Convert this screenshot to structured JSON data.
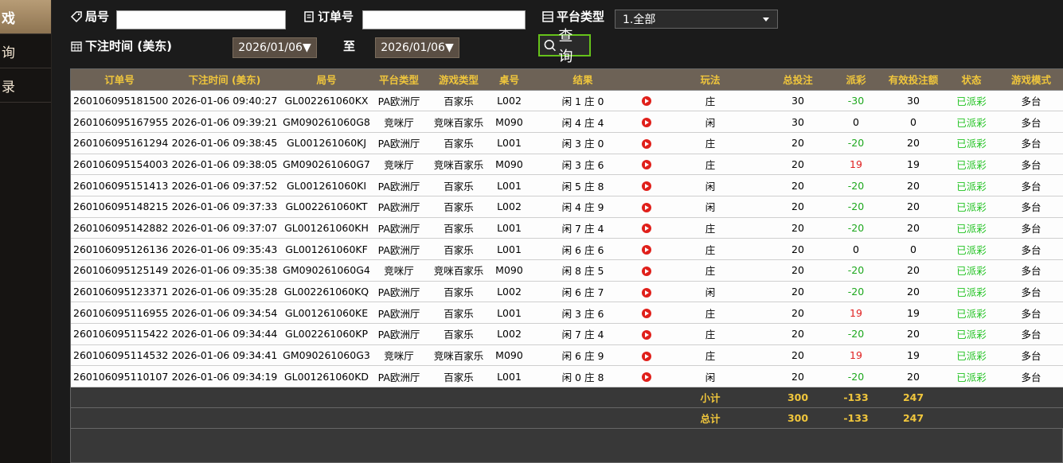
{
  "sidebar": {
    "items": [
      {
        "label": "戏",
        "active": true
      },
      {
        "label": "询",
        "active": false
      },
      {
        "label": "录",
        "active": false
      }
    ]
  },
  "filters": {
    "round_label": "局号",
    "round_value": "",
    "order_label": "订单号",
    "order_value": "",
    "platform_label": "平台类型",
    "platform_selected": "1.全部",
    "bet_time_label": "下注时间 (美东)",
    "date_from": "2026/01/06▼",
    "to_label": "至",
    "date_to": "2026/01/06▼",
    "search_label": "查询"
  },
  "table": {
    "headers": [
      "订单号",
      "下注时间 (美东)",
      "局号",
      "平台类型",
      "游戏类型",
      "桌号",
      "结果",
      "",
      "玩法",
      "总投注",
      "派彩",
      "有效投注额",
      "状态",
      "游戏模式"
    ],
    "rows": [
      {
        "order": "260106095181500",
        "time": "2026-01-06 09:40:27",
        "round": "GL002261060KX",
        "platform": "PA欧洲厅",
        "game": "百家乐",
        "table": "L002",
        "result": "闲 1 庄 0",
        "play": "庄",
        "bet": "30",
        "payout": "-30",
        "payout_type": "neg",
        "valid": "30",
        "status": "已派彩",
        "mode": "多台"
      },
      {
        "order": "260106095167955",
        "time": "2026-01-06 09:39:21",
        "round": "GM090261060G8",
        "platform": "竞咪厅",
        "game": "竞咪百家乐",
        "table": "M090",
        "result": "闲 4 庄 4",
        "play": "闲",
        "bet": "30",
        "payout": "0",
        "payout_type": "zero",
        "valid": "0",
        "status": "已派彩",
        "mode": "多台"
      },
      {
        "order": "260106095161294",
        "time": "2026-01-06 09:38:45",
        "round": "GL001261060KJ",
        "platform": "PA欧洲厅",
        "game": "百家乐",
        "table": "L001",
        "result": "闲 3 庄 0",
        "play": "庄",
        "bet": "20",
        "payout": "-20",
        "payout_type": "neg",
        "valid": "20",
        "status": "已派彩",
        "mode": "多台"
      },
      {
        "order": "260106095154003",
        "time": "2026-01-06 09:38:05",
        "round": "GM090261060G7",
        "platform": "竞咪厅",
        "game": "竞咪百家乐",
        "table": "M090",
        "result": "闲 3 庄 6",
        "play": "庄",
        "bet": "20",
        "payout": "19",
        "payout_type": "pos",
        "valid": "19",
        "status": "已派彩",
        "mode": "多台"
      },
      {
        "order": "260106095151413",
        "time": "2026-01-06 09:37:52",
        "round": "GL001261060KI",
        "platform": "PA欧洲厅",
        "game": "百家乐",
        "table": "L001",
        "result": "闲 5 庄 8",
        "play": "闲",
        "bet": "20",
        "payout": "-20",
        "payout_type": "neg",
        "valid": "20",
        "status": "已派彩",
        "mode": "多台"
      },
      {
        "order": "260106095148215",
        "time": "2026-01-06 09:37:33",
        "round": "GL002261060KT",
        "platform": "PA欧洲厅",
        "game": "百家乐",
        "table": "L002",
        "result": "闲 4 庄 9",
        "play": "闲",
        "bet": "20",
        "payout": "-20",
        "payout_type": "neg",
        "valid": "20",
        "status": "已派彩",
        "mode": "多台"
      },
      {
        "order": "260106095142882",
        "time": "2026-01-06 09:37:07",
        "round": "GL001261060KH",
        "platform": "PA欧洲厅",
        "game": "百家乐",
        "table": "L001",
        "result": "闲 7 庄 4",
        "play": "庄",
        "bet": "20",
        "payout": "-20",
        "payout_type": "neg",
        "valid": "20",
        "status": "已派彩",
        "mode": "多台"
      },
      {
        "order": "260106095126136",
        "time": "2026-01-06 09:35:43",
        "round": "GL001261060KF",
        "platform": "PA欧洲厅",
        "game": "百家乐",
        "table": "L001",
        "result": "闲 6 庄 6",
        "play": "庄",
        "bet": "20",
        "payout": "0",
        "payout_type": "zero",
        "valid": "0",
        "status": "已派彩",
        "mode": "多台"
      },
      {
        "order": "260106095125149",
        "time": "2026-01-06 09:35:38",
        "round": "GM090261060G4",
        "platform": "竞咪厅",
        "game": "竞咪百家乐",
        "table": "M090",
        "result": "闲 8 庄 5",
        "play": "庄",
        "bet": "20",
        "payout": "-20",
        "payout_type": "neg",
        "valid": "20",
        "status": "已派彩",
        "mode": "多台"
      },
      {
        "order": "260106095123371",
        "time": "2026-01-06 09:35:28",
        "round": "GL002261060KQ",
        "platform": "PA欧洲厅",
        "game": "百家乐",
        "table": "L002",
        "result": "闲 6 庄 7",
        "play": "闲",
        "bet": "20",
        "payout": "-20",
        "payout_type": "neg",
        "valid": "20",
        "status": "已派彩",
        "mode": "多台"
      },
      {
        "order": "260106095116955",
        "time": "2026-01-06 09:34:54",
        "round": "GL001261060KE",
        "platform": "PA欧洲厅",
        "game": "百家乐",
        "table": "L001",
        "result": "闲 3 庄 6",
        "play": "庄",
        "bet": "20",
        "payout": "19",
        "payout_type": "pos",
        "valid": "19",
        "status": "已派彩",
        "mode": "多台"
      },
      {
        "order": "260106095115422",
        "time": "2026-01-06 09:34:44",
        "round": "GL002261060KP",
        "platform": "PA欧洲厅",
        "game": "百家乐",
        "table": "L002",
        "result": "闲 7 庄 4",
        "play": "庄",
        "bet": "20",
        "payout": "-20",
        "payout_type": "neg",
        "valid": "20",
        "status": "已派彩",
        "mode": "多台"
      },
      {
        "order": "260106095114532",
        "time": "2026-01-06 09:34:41",
        "round": "GM090261060G3",
        "platform": "竞咪厅",
        "game": "竞咪百家乐",
        "table": "M090",
        "result": "闲 6 庄 9",
        "play": "庄",
        "bet": "20",
        "payout": "19",
        "payout_type": "pos",
        "valid": "19",
        "status": "已派彩",
        "mode": "多台"
      },
      {
        "order": "260106095110107",
        "time": "2026-01-06 09:34:19",
        "round": "GL001261060KD",
        "platform": "PA欧洲厅",
        "game": "百家乐",
        "table": "L001",
        "result": "闲 0 庄 8",
        "play": "闲",
        "bet": "20",
        "payout": "-20",
        "payout_type": "neg",
        "valid": "20",
        "status": "已派彩",
        "mode": "多台"
      }
    ],
    "subtotal": {
      "label": "小计",
      "bet": "300",
      "payout": "-133",
      "valid": "247"
    },
    "total": {
      "label": "总计",
      "bet": "300",
      "payout": "-133",
      "valid": "247"
    }
  },
  "colors": {
    "header_bg": "#6d6256",
    "header_text": "#f0c63c",
    "negative_payout": "#1ea81e",
    "positive_payout": "#e02020",
    "status_text": "#22c322",
    "search_border": "#66c21a",
    "sidebar_active": "#b79c76"
  }
}
